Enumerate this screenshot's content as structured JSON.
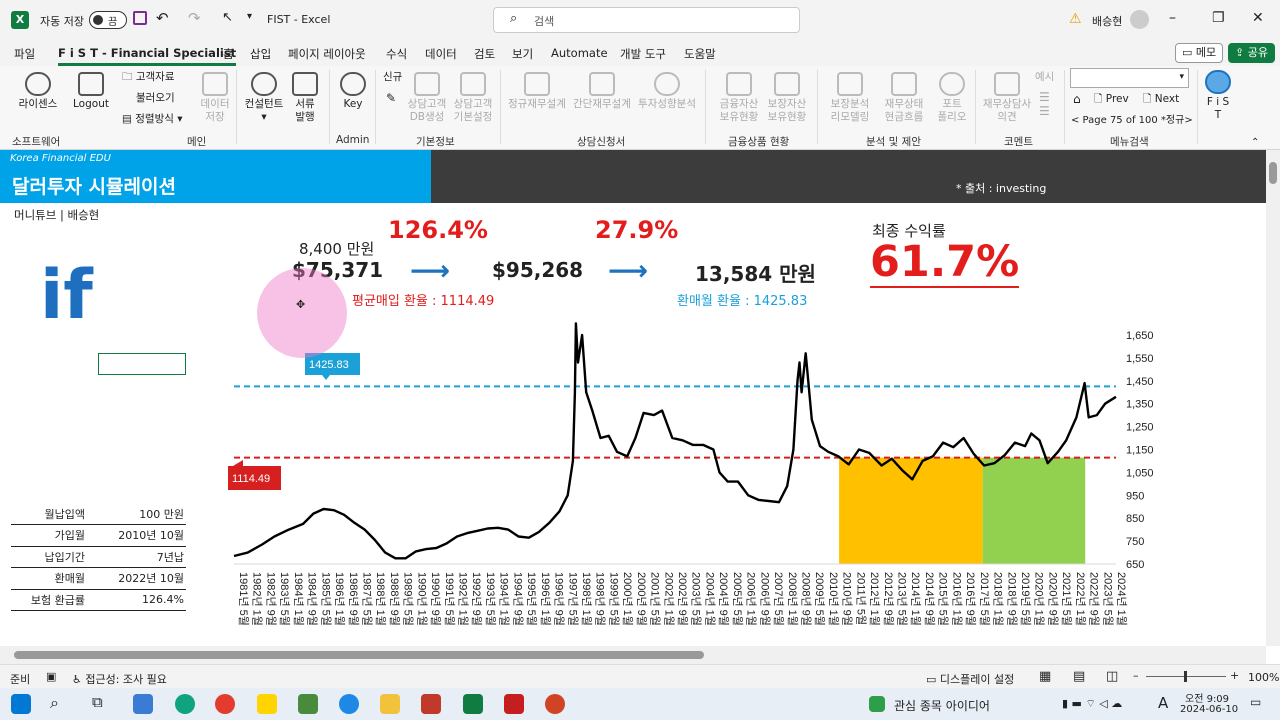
{
  "titlebar": {
    "autosave_label": "자동 저장",
    "autosave_state": "끔",
    "doc_title": "FIST  -  Excel",
    "search_placeholder": "검색",
    "user_name": "배승현"
  },
  "menu": {
    "items": [
      "파일",
      "F i S T  - Financial Specialist",
      "홈",
      "삽입",
      "페이지 레이아웃",
      "수식",
      "데이터",
      "검토",
      "보기",
      "Automate",
      "개발 도구",
      "도움말"
    ],
    "memo": "메모",
    "share": "공유"
  },
  "ribbon": {
    "license": "라이센스",
    "logout": "Logout",
    "customer_data": "고객자료",
    "load": "불러오기",
    "sort": "정렬방식",
    "data_save": "데이터\n저장",
    "consultant": "컨설턴트",
    "doc_issue": "서류\n발행",
    "key": "Key",
    "new": "신규",
    "consult_db": "상담고객\nDB생성",
    "consult_basic": "상담고객\n기본설정",
    "regular_plan": "정규재무설계",
    "simple_plan": "간단재무설계",
    "invest_analysis": "투자성향분석",
    "financial_assets": "금융자산\n보유현황",
    "insurance_assets": "보장자산\n보유현황",
    "coverage_analysis": "보장분석\n리모델링",
    "financial_status": "재무상태\n현금흐름",
    "portfolio": "포트\n폴리오",
    "consult_opinion": "재무상담사\n의견",
    "example": "예시",
    "prev": "Prev",
    "next": "Next",
    "page_info": "< Page 75 of 100 *정규>",
    "fist": "F i S\nT",
    "groups": [
      "소프트웨어",
      "메인",
      "Admin",
      "기본정보",
      "상담신청서",
      "금융상품 현황",
      "분석 및 제안",
      "코멘트",
      "메뉴검색"
    ]
  },
  "sheet": {
    "brand": "Korea Financial EDU",
    "title": "달러투자 시뮬레이션",
    "source": "* 출처 : investing",
    "author_line": "머니튜브  |  배승현",
    "if_text": "if",
    "principal_krw": "8,400 만원",
    "principal_usd": "$75,371",
    "gain1_pct": "126.4%",
    "final_usd": "$95,268",
    "gain2_pct": "27.9%",
    "final_krw": "13,584 만원",
    "avg_rate_text": "평균매입 환율 : 1114.49",
    "exit_rate_text": "환매월 환율 : 1425.83",
    "final_return_label": "최종 수익률",
    "final_return_value": "61.7%",
    "info": [
      {
        "label": "월납입액",
        "value": "100 만원"
      },
      {
        "label": "가입월",
        "value": "2010년 10월"
      },
      {
        "label": "납입기간",
        "value": "7년납"
      },
      {
        "label": "환매월",
        "value": "2022년 10월"
      },
      {
        "label": "보험 환급률",
        "value": "126.4%"
      }
    ]
  },
  "chart_data": {
    "type": "line",
    "ylim": [
      650,
      1650
    ],
    "yticks": [
      "1,650",
      "1,550",
      "1,450",
      "1,350",
      "1,250",
      "1,150",
      "1,050",
      "950",
      "850",
      "750",
      "650"
    ],
    "xtick_labels": [
      "1981년 5월",
      "1982년 1월",
      "1982년 9월",
      "1983년 5월",
      "1984년 1월",
      "1984년 9월",
      "1985년 5월",
      "1986년 1월",
      "1986년 9월",
      "1987년 5월",
      "1988년 1월",
      "1988년 9월",
      "1989년 5월",
      "1990년 1월",
      "1990년 9월",
      "1991년 5월",
      "1992년 1월",
      "1992년 9월",
      "1993년 5월",
      "1994년 1월",
      "1994년 9월",
      "1995년 5월",
      "1996년 1월",
      "1996년 9월",
      "1997년 5월",
      "1998년 1월",
      "1998년 9월",
      "1999년 5월",
      "2000년 1월",
      "2000년 9월",
      "2001년 5월",
      "2002년 1월",
      "2002년 9월",
      "2003년 5월",
      "2004년 1월",
      "2004년 9월",
      "2005년 5월",
      "2006년 1월",
      "2006년 9월",
      "2007년 5월",
      "2008년 1월",
      "2008년 9월",
      "2009년 5월",
      "2010년 1월",
      "2010년 9월",
      "2011년 5월",
      "2012년 1월",
      "2012년 9월",
      "2013년 5월",
      "2014년 1월",
      "2014년 9월",
      "2015년 5월",
      "2016년 1월",
      "2016년 9월",
      "2017년 5월",
      "2018년 1월",
      "2018년 9월",
      "2019년 5월",
      "2020년 1월",
      "2020년 9월",
      "2021년 5월",
      "2022년 1월",
      "2022년 9월",
      "2023년 5월",
      "2024년 1월"
    ],
    "x_range": [
      1981.33,
      2024.33
    ],
    "series": [
      {
        "color": "#000000",
        "points": [
          [
            1981.33,
            685
          ],
          [
            1982.0,
            700
          ],
          [
            1982.7,
            735
          ],
          [
            1983.3,
            770
          ],
          [
            1984.0,
            800
          ],
          [
            1984.7,
            825
          ],
          [
            1985.2,
            870
          ],
          [
            1985.7,
            890
          ],
          [
            1986.2,
            885
          ],
          [
            1986.7,
            865
          ],
          [
            1987.2,
            830
          ],
          [
            1987.7,
            800
          ],
          [
            1988.2,
            755
          ],
          [
            1988.7,
            700
          ],
          [
            1989.2,
            675
          ],
          [
            1989.7,
            675
          ],
          [
            1990.2,
            705
          ],
          [
            1990.7,
            715
          ],
          [
            1991.2,
            720
          ],
          [
            1991.7,
            740
          ],
          [
            1992.2,
            770
          ],
          [
            1992.7,
            785
          ],
          [
            1993.2,
            795
          ],
          [
            1993.7,
            805
          ],
          [
            1994.2,
            808
          ],
          [
            1994.7,
            800
          ],
          [
            1995.2,
            770
          ],
          [
            1995.7,
            765
          ],
          [
            1996.2,
            790
          ],
          [
            1996.7,
            830
          ],
          [
            1997.2,
            880
          ],
          [
            1997.6,
            950
          ],
          [
            1997.85,
            1100
          ],
          [
            1997.95,
            1400
          ],
          [
            1998.0,
            1700
          ],
          [
            1998.1,
            1530
          ],
          [
            1998.3,
            1650
          ],
          [
            1998.5,
            1400
          ],
          [
            1998.8,
            1320
          ],
          [
            1999.2,
            1200
          ],
          [
            1999.6,
            1210
          ],
          [
            2000.0,
            1140
          ],
          [
            2000.5,
            1120
          ],
          [
            2000.9,
            1200
          ],
          [
            2001.3,
            1310
          ],
          [
            2001.8,
            1300
          ],
          [
            2002.2,
            1320
          ],
          [
            2002.7,
            1200
          ],
          [
            2003.2,
            1190
          ],
          [
            2003.7,
            1170
          ],
          [
            2004.2,
            1170
          ],
          [
            2004.7,
            1150
          ],
          [
            2005.0,
            1050
          ],
          [
            2005.4,
            1010
          ],
          [
            2005.9,
            1010
          ],
          [
            2006.4,
            950
          ],
          [
            2006.9,
            930
          ],
          [
            2007.4,
            925
          ],
          [
            2007.9,
            920
          ],
          [
            2008.3,
            990
          ],
          [
            2008.6,
            1150
          ],
          [
            2008.8,
            1450
          ],
          [
            2008.9,
            1530
          ],
          [
            2009.0,
            1400
          ],
          [
            2009.2,
            1570
          ],
          [
            2009.5,
            1280
          ],
          [
            2009.9,
            1165
          ],
          [
            2010.3,
            1140
          ],
          [
            2010.8,
            1120
          ],
          [
            2011.3,
            1085
          ],
          [
            2011.8,
            1150
          ],
          [
            2012.3,
            1135
          ],
          [
            2012.9,
            1080
          ],
          [
            2013.4,
            1110
          ],
          [
            2013.9,
            1060
          ],
          [
            2014.4,
            1020
          ],
          [
            2014.9,
            1100
          ],
          [
            2015.4,
            1120
          ],
          [
            2015.9,
            1180
          ],
          [
            2016.4,
            1160
          ],
          [
            2016.9,
            1200
          ],
          [
            2017.4,
            1130
          ],
          [
            2017.9,
            1080
          ],
          [
            2018.4,
            1090
          ],
          [
            2018.9,
            1125
          ],
          [
            2019.4,
            1180
          ],
          [
            2019.9,
            1165
          ],
          [
            2020.2,
            1220
          ],
          [
            2020.6,
            1190
          ],
          [
            2021.0,
            1090
          ],
          [
            2021.5,
            1140
          ],
          [
            2021.9,
            1190
          ],
          [
            2022.4,
            1290
          ],
          [
            2022.8,
            1440
          ],
          [
            2023.0,
            1290
          ],
          [
            2023.4,
            1300
          ],
          [
            2023.8,
            1350
          ],
          [
            2024.33,
            1380
          ]
        ]
      }
    ],
    "ref_lines": [
      {
        "value": 1425.83,
        "color": "#1ba1d8",
        "label": "1425.83"
      },
      {
        "value": 1114.49,
        "color": "#d62020",
        "label": "1114.49"
      }
    ],
    "bands": [
      {
        "x0": 2010.83,
        "x1": 2017.83,
        "top": 1114.49,
        "color": "#ffc000"
      },
      {
        "x0": 2017.83,
        "x1": 2022.83,
        "top": 1114.49,
        "color": "#92d050"
      }
    ]
  },
  "statusbar": {
    "ready": "준비",
    "accessibility": "접근성: 조사 필요",
    "display_settings": "디스플레이 설정",
    "zoom": "100%"
  },
  "taskbar": {
    "news": "관심 종목 아이디어",
    "time": "오전 9:09",
    "date": "2024-06-10",
    "lang": "A"
  }
}
